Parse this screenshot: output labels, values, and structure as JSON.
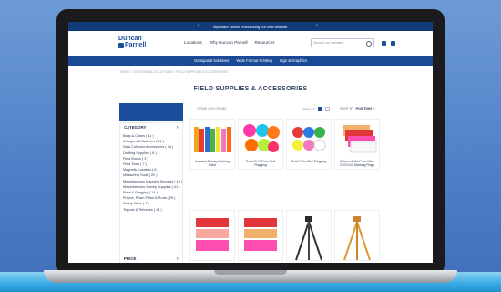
{
  "promo": {
    "text": "Important Notice: Introducing our new website."
  },
  "header": {
    "logo_line1": "Duncan",
    "logo_line2": "Parnell",
    "nav": [
      "Locations",
      "Why Duncan Parnell",
      "Resources"
    ],
    "search_placeholder": "Search our website"
  },
  "subnav": [
    "Geospatial Solutions",
    "Wide Format Printing",
    "Sign & Graphics"
  ],
  "breadcrumb": "HOME  >  GEOSPATIAL SOLUTIONS  >  FIELD SUPPLIES & ACCESSORIES",
  "page_title": "FIELD SUPPLIES & ACCESSORIES",
  "toolbar": {
    "items_count": "ITEMS 1-20 OF 283",
    "view_as": "VIEW AS",
    "sort_by": "SORT BY",
    "sort_value": "POSITION"
  },
  "sidebar": {
    "category_title": "CATEGORY",
    "categories": [
      "Bags & Cases  ( 11 )",
      "Chargers & Batteries  ( 21 )",
      "Data Collector Accessories  ( 46 )",
      "Drafting Supplies  ( 8 )",
      "Field Books  ( 3 )",
      "Field Tools  ( 7 )",
      "Magnetic Locators  ( 6 )",
      "Measuring Tools  ( 20 )",
      "Miscellaneous Mapping Supplies  ( 10 )",
      "Miscellaneous Survey Supplies  ( 41 )",
      "Paint & Flagging  ( 14 )",
      "Prisms, Prism Poles & Rods  ( 25 )",
      "Safety Wear  ( 7 )",
      "Tripods & Tribrachs  ( 13 )"
    ],
    "price_title": "PRICE"
  },
  "products": [
    "Inverted Survey Marking Paint",
    "Solid GLO Color Roll Flagging",
    "Solid Color Roll Flagging",
    "Presco Solid Color Wire 2\"x3\"x34\" Marking Flags"
  ],
  "colors": {
    "navy": "#1b4e9b",
    "promo": "#123b7a",
    "accent_blue": "#38a9e4"
  }
}
